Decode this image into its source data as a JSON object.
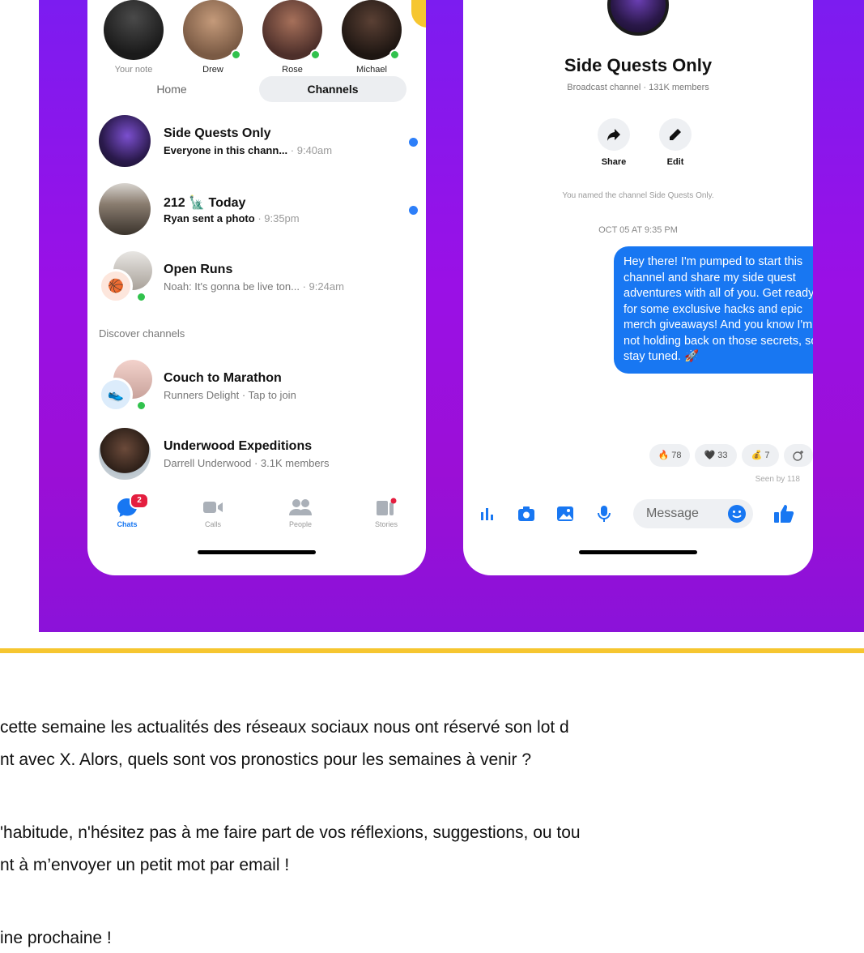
{
  "left_phone": {
    "stories": [
      {
        "name": "Your note"
      },
      {
        "name": "Drew"
      },
      {
        "name": "Rose"
      },
      {
        "name": "Michael"
      }
    ],
    "tabs": {
      "home": "Home",
      "channels": "Channels"
    },
    "chats": [
      {
        "title": "Side Quests Only",
        "preview": "Everyone in this chann...",
        "time": "· 9:40am",
        "unread": true
      },
      {
        "title": "212 🗽 Today",
        "preview": "Ryan sent a photo",
        "time": "· 9:35pm",
        "unread": true
      },
      {
        "title": "Open Runs",
        "preview": "Noah: It's gonna be live ton...",
        "time": "· 9:24am",
        "unread": false
      }
    ],
    "discover_label": "Discover channels",
    "discover": [
      {
        "title": "Couch to Marathon",
        "sub": "Runners Delight · Tap to join"
      },
      {
        "title": "Underwood Expeditions",
        "sub": "Darrell Underwood · 3.1K members"
      }
    ],
    "nav": [
      {
        "label": "Chats",
        "badge": "2"
      },
      {
        "label": "Calls"
      },
      {
        "label": "People"
      },
      {
        "label": "Stories"
      }
    ]
  },
  "right_phone": {
    "title": "Side Quests Only",
    "subtitle": "Broadcast channel · 131K members",
    "actions": {
      "share": "Share",
      "edit": "Edit"
    },
    "system_note": "You named the channel Side Quests Only.",
    "date": "OCT 05 AT 9:35 PM",
    "message": "Hey there! I'm pumped to start this channel and share my side quest adventures with all of you. Get ready for some exclusive hacks and epic merch giveaways! And you know I'm not holding back on those secrets, so stay tuned. 🚀",
    "reactions": [
      {
        "emoji": "🔥",
        "count": "78"
      },
      {
        "emoji": "🖤",
        "count": "33"
      },
      {
        "emoji": "💰",
        "count": "7"
      }
    ],
    "seen": "Seen by 118",
    "composer_placeholder": "Message"
  },
  "article": {
    "line1": "cette semaine les actualités des réseaux sociaux nous ont réservé son lot d",
    "line2": "nt avec X. Alors, quels sont vos pronostics pour les semaines à venir ?",
    "line3": "'habitude, n'hésitez pas à me faire part de vos réflexions, suggestions, ou tou",
    "line4": "nt à m’envoyer un petit mot par email !",
    "line5": "ine prochaine !"
  },
  "colors": {
    "accent": "#1877f2",
    "gradient": "#9a10e6",
    "divider": "#f6c630",
    "online": "#31c24d"
  }
}
